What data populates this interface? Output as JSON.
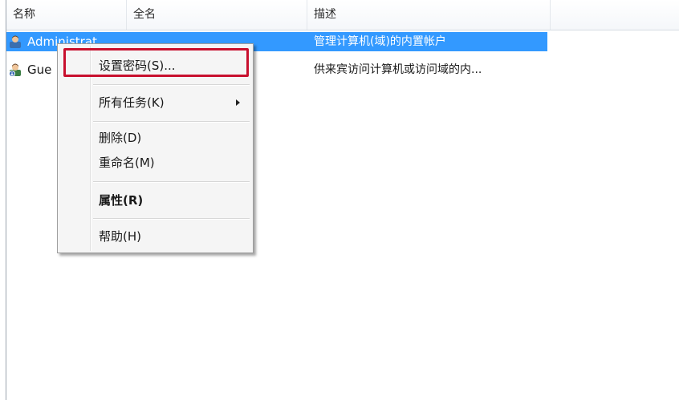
{
  "header": {
    "col_name": "名称",
    "col_fullname": "全名",
    "col_description": "描述"
  },
  "rows": [
    {
      "name": "Administrat",
      "fullname": "",
      "description": "管理计算机(域)的内置帐户",
      "selected": true,
      "icon": "user-admin-icon"
    },
    {
      "name": "Gue",
      "fullname": "",
      "description": "供来宾访问计算机或访问域的内...",
      "selected": false,
      "icon": "user-guest-icon"
    }
  ],
  "context_menu": {
    "items": [
      {
        "label": "设置密码(S)...",
        "highlighted": true
      },
      {
        "label": "所有任务(K)",
        "has_submenu": true
      },
      {
        "label": "删除(D)"
      },
      {
        "label": "重命名(M)"
      },
      {
        "label": "属性(R)",
        "bold": true
      },
      {
        "label": "帮助(H)"
      }
    ]
  },
  "colors": {
    "selection": "#3399ff",
    "highlight_border": "#c8102e"
  }
}
